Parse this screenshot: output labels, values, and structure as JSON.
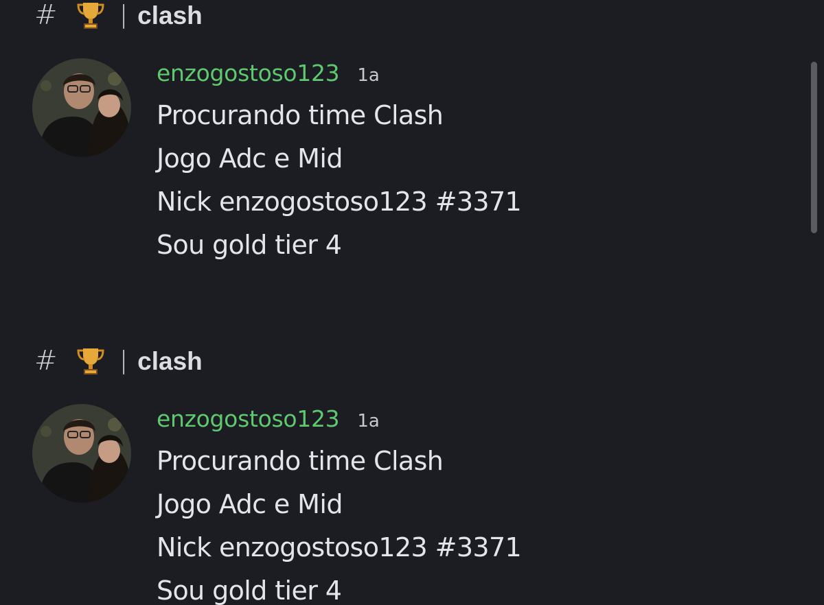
{
  "channel": {
    "hash_icon": "#",
    "emoji_icon": "trophy-icon",
    "separator": "|",
    "name": "clash"
  },
  "messages": [
    {
      "username": "enzogostoso123",
      "timestamp": "1a",
      "lines": [
        "Procurando time Clash",
        "Jogo Adc e Mid",
        "Nick enzogostoso123 #3371",
        "Sou gold tier 4"
      ]
    },
    {
      "username": "enzogostoso123",
      "timestamp": "1a",
      "lines": [
        "Procurando time Clash",
        "Jogo Adc e Mid",
        "Nick enzogostoso123 #3371",
        "Sou gold tier 4"
      ]
    }
  ],
  "colors": {
    "background": "#1c1d22",
    "username": "#5fc96f",
    "text": "#e4e5ea"
  }
}
